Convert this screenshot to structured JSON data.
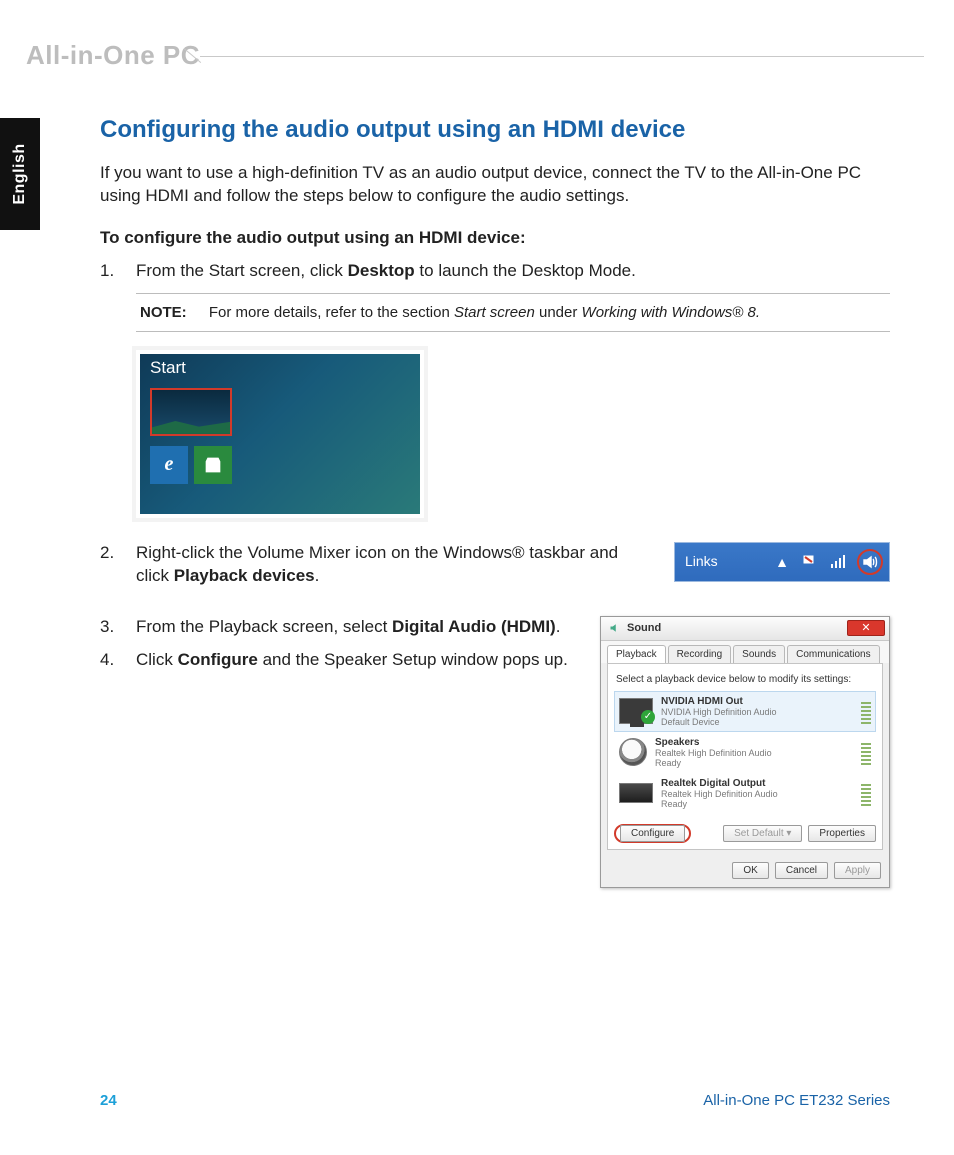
{
  "header": {
    "title": "All-in-One PC"
  },
  "sideTab": {
    "label": "English"
  },
  "section_title": "Configuring the audio output using an HDMI device",
  "intro": "If you want to use a high-definition TV as an audio output device, connect the TV to the All-in-One PC using HDMI and follow the steps below to configure the audio settings.",
  "lead": "To configure the audio output using an HDMI device:",
  "steps": {
    "s1": {
      "num": "1.",
      "pre": "From the Start screen, click ",
      "bold": "Desktop",
      "post": " to launch the Desktop Mode."
    },
    "s2": {
      "num": "2.",
      "pre": "Right-click the Volume Mixer icon on the Windows® taskbar and click ",
      "bold": "Playback devices",
      "post": "."
    },
    "s3": {
      "num": "3.",
      "pre": "From the Playback screen, select ",
      "bold": "Digital Audio (HDMI)",
      "post": "."
    },
    "s4": {
      "num": "4.",
      "pre": "Click ",
      "bold": "Configure",
      "post": " and the Speaker Setup window pops up."
    }
  },
  "note": {
    "label": "NOTE:",
    "pre": "For more details, refer to the section ",
    "it1": "Start screen",
    "mid": " under ",
    "it2": "Working with Windows® 8."
  },
  "startFig": {
    "label": "Start"
  },
  "taskbar": {
    "links": "Links",
    "upGlyph": "▲"
  },
  "sound": {
    "title": "Sound",
    "tabs": {
      "t1": "Playback",
      "t2": "Recording",
      "t3": "Sounds",
      "t4": "Communications"
    },
    "hint": "Select a playback device below to modify its settings:",
    "devices": [
      {
        "name": "NVIDIA HDMI Out",
        "sub": "NVIDIA High Definition Audio",
        "state": "Default Device"
      },
      {
        "name": "Speakers",
        "sub": "Realtek High Definition Audio",
        "state": "Ready"
      },
      {
        "name": "Realtek Digital Output",
        "sub": "Realtek High Definition Audio",
        "state": "Ready"
      }
    ],
    "buttons": {
      "configure": "Configure",
      "setdefault": "Set Default",
      "properties": "Properties",
      "ok": "OK",
      "cancel": "Cancel",
      "apply": "Apply"
    }
  },
  "footer": {
    "page": "24",
    "series": "All-in-One PC ET232 Series"
  }
}
